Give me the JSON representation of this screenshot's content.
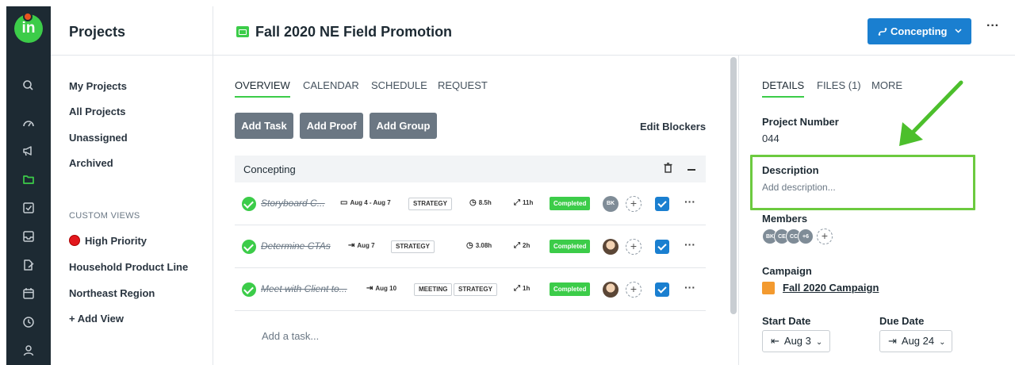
{
  "rail": {
    "logo_text": "in",
    "icons": [
      "search-icon",
      "dashboard-icon",
      "megaphone-icon",
      "folder-icon",
      "checkbox-icon",
      "inbox-icon",
      "proof-icon",
      "calendar-icon",
      "clock-icon",
      "user-icon"
    ],
    "active_icon": "folder-icon"
  },
  "sidebar": {
    "title": "Projects",
    "links": [
      "My Projects",
      "All Projects",
      "Unassigned",
      "Archived"
    ],
    "custom_views_label": "CUSTOM VIEWS",
    "custom_views": [
      "High Priority",
      "Household Product Line",
      "Northeast Region"
    ],
    "add_view_label": "+ Add View"
  },
  "header": {
    "project_title": "Fall 2020 NE Field Promotion",
    "status_label": "Concepting",
    "more_label": "···",
    "status_color": "#1a7fd0"
  },
  "main": {
    "tabs": [
      "OVERVIEW",
      "CALENDAR",
      "SCHEDULE",
      "REQUEST"
    ],
    "active_tab": "OVERVIEW",
    "buttons": [
      "Add Task",
      "Add Proof",
      "Add Group"
    ],
    "edit_blockers": "Edit Blockers",
    "group_name": "Concepting",
    "tasks": [
      {
        "name": "Storyboard C...",
        "date": "Aug 4 - Aug 7",
        "tags": [
          "STRATEGY"
        ],
        "estimate": "8.5h",
        "logged": "11h",
        "status": "Completed",
        "assignee": "BK"
      },
      {
        "name": "Determine CTAs",
        "date": "Aug 7",
        "tags": [
          "STRATEGY"
        ],
        "estimate": "3.08h",
        "logged": "2h",
        "status": "Completed",
        "assignee": "photo"
      },
      {
        "name": "Meet with Client to...",
        "date": "Aug 10",
        "tags": [
          "MEETING",
          "STRATEGY"
        ],
        "estimate": "",
        "logged": "1h",
        "status": "Completed",
        "assignee": "photo"
      }
    ],
    "add_task_placeholder": "Add a task..."
  },
  "details": {
    "tabs": [
      "DETAILS",
      "FILES (1)",
      "MORE"
    ],
    "active_tab": "DETAILS",
    "project_number_label": "Project Number",
    "project_number": "044",
    "description_label": "Description",
    "description_placeholder": "Add description...",
    "members_label": "Members",
    "members": [
      "BK",
      "CE",
      "CC",
      "+6"
    ],
    "campaign_label": "Campaign",
    "campaign_name": "Fall 2020 Campaign",
    "start_date_label": "Start Date",
    "start_date": "Aug 3",
    "due_date_label": "Due Date",
    "due_date": "Aug 24"
  },
  "colors": {
    "accent_green": "#3ccc49",
    "primary_blue": "#1a7fd0",
    "highlight_green": "#6cca3f",
    "rail_dark": "#1d2a33"
  }
}
